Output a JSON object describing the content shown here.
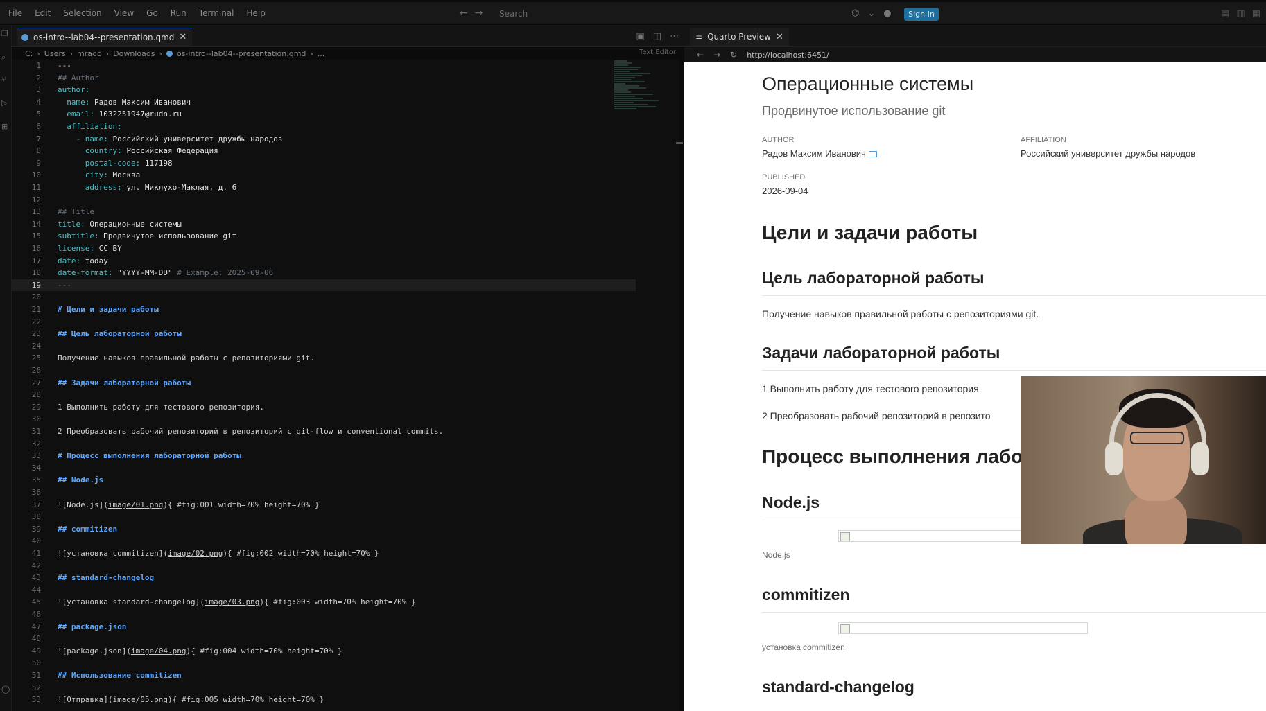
{
  "menubar": {
    "items": [
      "File",
      "Edit",
      "Selection",
      "View",
      "Go",
      "Run",
      "Terminal",
      "Help"
    ],
    "search_placeholder": "Search",
    "sign_in_label": "Sign In"
  },
  "editor": {
    "tab_label": "os-intro--lab04--presentation.qmd",
    "breadcrumb": [
      "C:",
      "Users",
      "mrado",
      "Downloads",
      "os-intro--lab04--presentation.qmd",
      "..."
    ],
    "text_editor_label": "Text Editor",
    "current_line": 19,
    "lines": [
      {
        "n": "1",
        "parts": [
          {
            "c": "t",
            "x": "---"
          }
        ]
      },
      {
        "n": "2",
        "parts": [
          {
            "c": "c",
            "x": "## Author"
          }
        ]
      },
      {
        "n": "3",
        "parts": [
          {
            "c": "k",
            "x": "author:"
          }
        ]
      },
      {
        "n": "4",
        "parts": [
          {
            "c": "k",
            "x": "  name: "
          },
          {
            "c": "v",
            "x": "Радов Максим Иванович"
          }
        ]
      },
      {
        "n": "5",
        "parts": [
          {
            "c": "k",
            "x": "  email: "
          },
          {
            "c": "v",
            "x": "1032251947@rudn.ru"
          }
        ]
      },
      {
        "n": "6",
        "parts": [
          {
            "c": "k",
            "x": "  affiliation:"
          }
        ]
      },
      {
        "n": "7",
        "parts": [
          {
            "c": "k",
            "x": "    - name: "
          },
          {
            "c": "v",
            "x": "Российский университет дружбы народов"
          }
        ]
      },
      {
        "n": "8",
        "parts": [
          {
            "c": "k",
            "x": "      country: "
          },
          {
            "c": "v",
            "x": "Российская Федерация"
          }
        ]
      },
      {
        "n": "9",
        "parts": [
          {
            "c": "k",
            "x": "      postal-code: "
          },
          {
            "c": "v",
            "x": "117198"
          }
        ]
      },
      {
        "n": "10",
        "parts": [
          {
            "c": "k",
            "x": "      city: "
          },
          {
            "c": "v",
            "x": "Москва"
          }
        ]
      },
      {
        "n": "11",
        "parts": [
          {
            "c": "k",
            "x": "      address: "
          },
          {
            "c": "v",
            "x": "ул. Миклухо-Маклая, д. 6"
          }
        ]
      },
      {
        "n": "12",
        "parts": []
      },
      {
        "n": "13",
        "parts": [
          {
            "c": "c",
            "x": "## Title"
          }
        ]
      },
      {
        "n": "14",
        "parts": [
          {
            "c": "k",
            "x": "title: "
          },
          {
            "c": "v",
            "x": "Операционные системы"
          }
        ]
      },
      {
        "n": "15",
        "parts": [
          {
            "c": "k",
            "x": "subtitle: "
          },
          {
            "c": "v",
            "x": "Продвинутое использование git"
          }
        ]
      },
      {
        "n": "16",
        "parts": [
          {
            "c": "k",
            "x": "license: "
          },
          {
            "c": "v",
            "x": "CC BY"
          }
        ]
      },
      {
        "n": "17",
        "parts": [
          {
            "c": "k",
            "x": "date: "
          },
          {
            "c": "v",
            "x": "today"
          }
        ]
      },
      {
        "n": "18",
        "parts": [
          {
            "c": "k",
            "x": "date-format: "
          },
          {
            "c": "s",
            "x": "\"YYYY-MM-DD\" "
          },
          {
            "c": "c",
            "x": "# Example: 2025-09-06"
          }
        ]
      },
      {
        "n": "19",
        "parts": [
          {
            "c": "c",
            "x": "---"
          }
        ]
      },
      {
        "n": "20",
        "parts": []
      },
      {
        "n": "21",
        "parts": [
          {
            "c": "h",
            "x": "# Цели и задачи работы"
          }
        ]
      },
      {
        "n": "22",
        "parts": []
      },
      {
        "n": "23",
        "parts": [
          {
            "c": "h",
            "x": "## Цель лабораторной работы"
          }
        ]
      },
      {
        "n": "24",
        "parts": []
      },
      {
        "n": "25",
        "parts": [
          {
            "c": "t",
            "x": "Получение навыков правильной работы с репозиториями git."
          }
        ]
      },
      {
        "n": "26",
        "parts": []
      },
      {
        "n": "27",
        "parts": [
          {
            "c": "h",
            "x": "## Задачи лабораторной работы"
          }
        ]
      },
      {
        "n": "28",
        "parts": []
      },
      {
        "n": "29",
        "parts": [
          {
            "c": "t",
            "x": "1 Выполнить работу для тестового репозитория."
          }
        ]
      },
      {
        "n": "30",
        "parts": []
      },
      {
        "n": "31",
        "parts": [
          {
            "c": "t",
            "x": "2 Преобразовать рабочий репозиторий в репозиторий с git-flow и conventional commits."
          }
        ]
      },
      {
        "n": "32",
        "parts": []
      },
      {
        "n": "33",
        "parts": [
          {
            "c": "h",
            "x": "# Процесс выполнения лабораторной работы"
          }
        ]
      },
      {
        "n": "34",
        "parts": []
      },
      {
        "n": "35",
        "parts": [
          {
            "c": "h",
            "x": "## Node.js"
          }
        ]
      },
      {
        "n": "36",
        "parts": []
      },
      {
        "n": "37",
        "parts": [
          {
            "c": "t",
            "x": "![Node.js]("
          },
          {
            "c": "u",
            "x": "image/01.png"
          },
          {
            "c": "t",
            "x": "){ #fig:001 width=70% height=70% }"
          }
        ]
      },
      {
        "n": "38",
        "parts": []
      },
      {
        "n": "39",
        "parts": [
          {
            "c": "h",
            "x": "## commitizen"
          }
        ]
      },
      {
        "n": "40",
        "parts": []
      },
      {
        "n": "41",
        "parts": [
          {
            "c": "t",
            "x": "![установка commitizen]("
          },
          {
            "c": "u",
            "x": "image/02.png"
          },
          {
            "c": "t",
            "x": "){ #fig:002 width=70% height=70% }"
          }
        ]
      },
      {
        "n": "42",
        "parts": []
      },
      {
        "n": "43",
        "parts": [
          {
            "c": "h",
            "x": "## standard-changelog"
          }
        ]
      },
      {
        "n": "44",
        "parts": []
      },
      {
        "n": "45",
        "parts": [
          {
            "c": "t",
            "x": "![установка standard-changelog]("
          },
          {
            "c": "u",
            "x": "image/03.png"
          },
          {
            "c": "t",
            "x": "){ #fig:003 width=70% height=70% }"
          }
        ]
      },
      {
        "n": "46",
        "parts": []
      },
      {
        "n": "47",
        "parts": [
          {
            "c": "h",
            "x": "## package.json"
          }
        ]
      },
      {
        "n": "48",
        "parts": []
      },
      {
        "n": "49",
        "parts": [
          {
            "c": "t",
            "x": "![package.json]("
          },
          {
            "c": "u",
            "x": "image/04.png"
          },
          {
            "c": "t",
            "x": "){ #fig:004 width=70% height=70% }"
          }
        ]
      },
      {
        "n": "50",
        "parts": []
      },
      {
        "n": "51",
        "parts": [
          {
            "c": "h",
            "x": "## Использование commitizen"
          }
        ]
      },
      {
        "n": "52",
        "parts": []
      },
      {
        "n": "53",
        "parts": [
          {
            "c": "t",
            "x": "![Отправка]("
          },
          {
            "c": "u",
            "x": "image/05.png"
          },
          {
            "c": "t",
            "x": "){ #fig:005 width=70% height=70% }"
          }
        ]
      }
    ]
  },
  "preview": {
    "tab_label": "Quarto Preview",
    "url": "http://localhost:6451/",
    "title": "Операционные системы",
    "subtitle": "Продвинутое использование git",
    "author_label": "AUTHOR",
    "author_name": "Радов Максим Иванович",
    "affiliation_label": "AFFILIATION",
    "affiliation_value": "Российский университет дружбы народов",
    "published_label": "PUBLISHED",
    "published_value": "2026-09-04",
    "section1_heading": "Цели и задачи работы",
    "goal_heading": "Цель лабораторной работы",
    "goal_text": "Получение навыков правильной работы с репозиториями git.",
    "tasks_heading": "Задачи лабораторной работы",
    "task1": "1 Выполнить работу для тестового репозитория.",
    "task2": "2 Преобразовать рабочий репозиторий в репозито",
    "process_heading": "Процесс выполнения лабо",
    "nodejs_heading": "Node.js",
    "nodejs_caption": "Node.js",
    "commitizen_heading": "commitizen",
    "commitizen_caption": "установка commitizen",
    "changelog_heading": "standard-changelog"
  }
}
